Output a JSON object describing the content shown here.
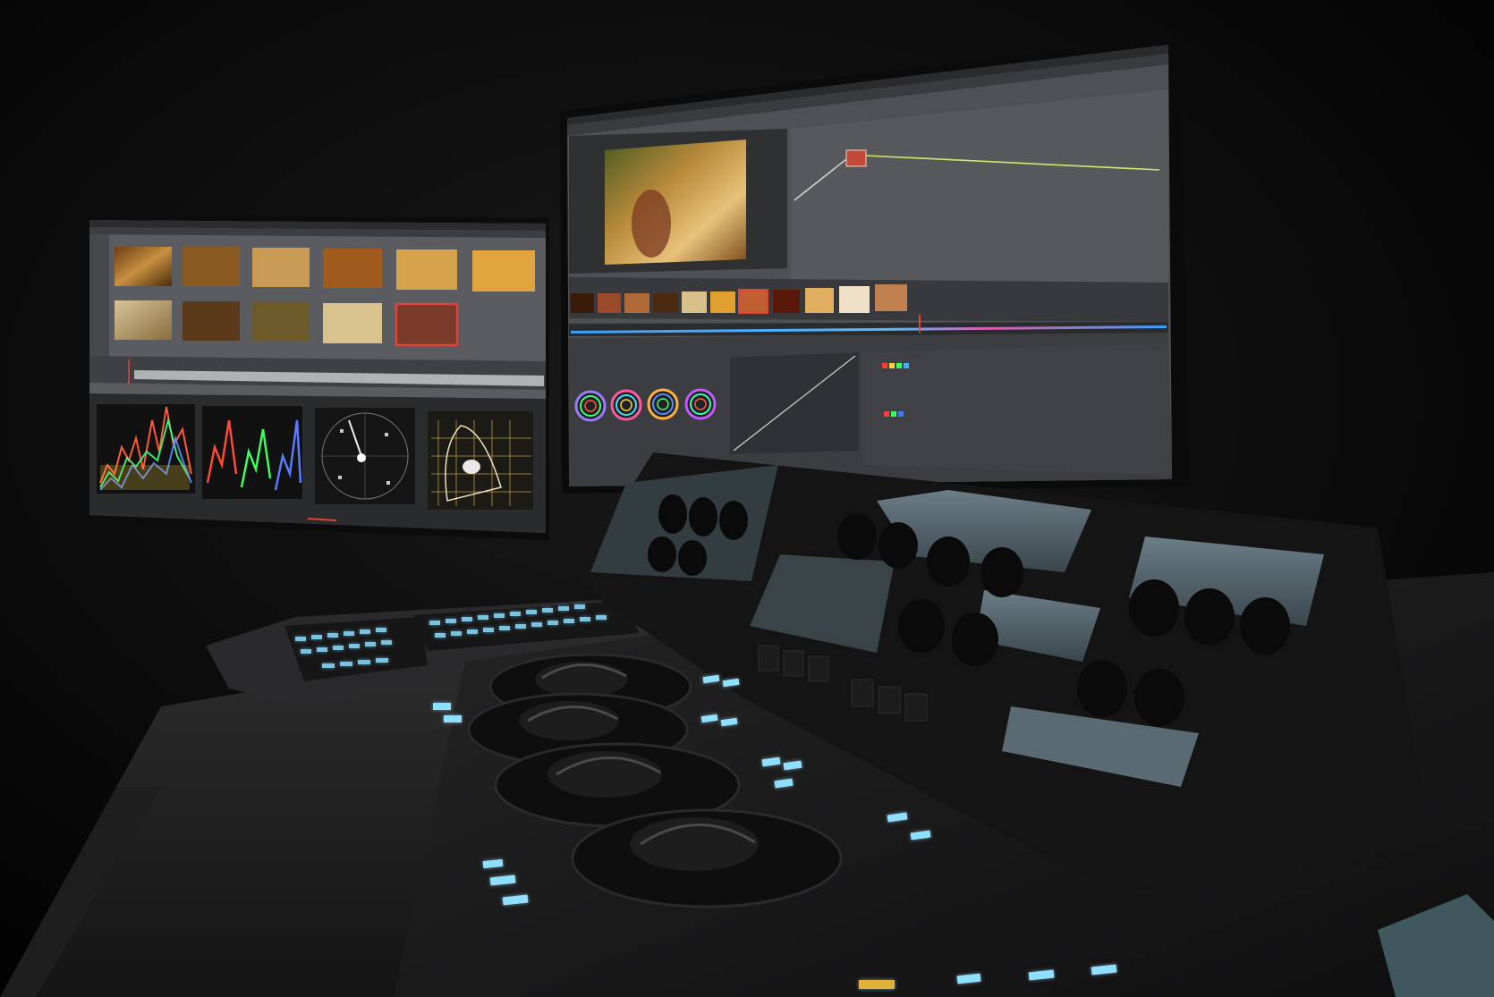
{
  "scene": {
    "description_tag": "color-grading-suite-photo",
    "colors": {
      "background": "#050505",
      "screen_gray": "#56585c",
      "panel_dark": "#1c1c1d",
      "key_backlight": "#8fe0ff",
      "accent_red": "#e0433a"
    },
    "left_monitor": {
      "thumbnail_count": 11,
      "scope_types": [
        "waveform",
        "parade",
        "vectorscope",
        "cie-chromaticity"
      ]
    },
    "right_monitor": {
      "primaries_wheel_count": 4,
      "timeline_clip_count": 12
    },
    "control_panel": {
      "trackball_count": 4,
      "knob_bank_count": 6
    }
  }
}
